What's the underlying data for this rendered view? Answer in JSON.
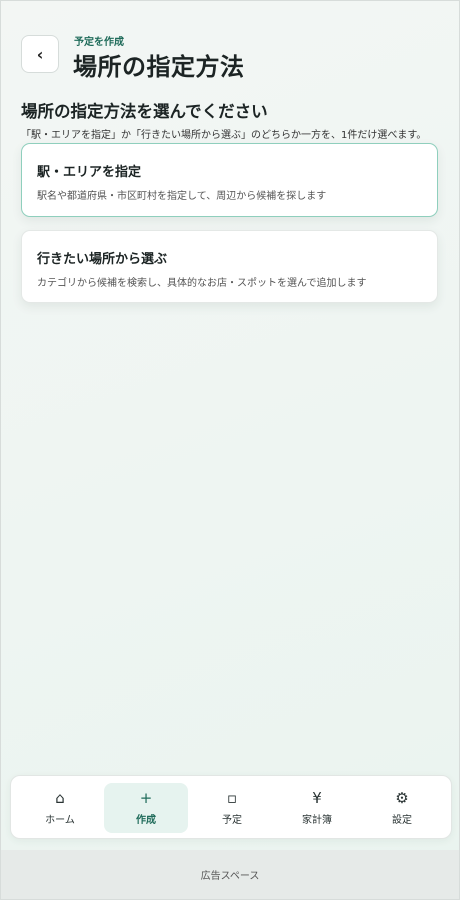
{
  "header": {
    "back_label": "‹",
    "eyebrow": "予定を作成",
    "title": "場所の指定方法"
  },
  "section": {
    "heading": "場所の指定方法を選んでください",
    "description": "「駅・エリアを指定」か「行きたい場所から選ぶ」のどちらか一方を、1件だけ選べます。"
  },
  "options": [
    {
      "title": "駅・エリアを指定",
      "description": "駅名や都道府県・市区町村を指定して、周辺から候補を探します",
      "selected": true
    },
    {
      "title": "行きたい場所から選ぶ",
      "description": "カテゴリから候補を検索し、具体的なお店・スポットを選んで追加します",
      "selected": false
    }
  ],
  "tabbar": {
    "items": [
      {
        "icon": "home-icon",
        "glyph": "⌂",
        "label": "ホーム"
      },
      {
        "icon": "plus-icon",
        "glyph": "+",
        "label": "作成",
        "active": true
      },
      {
        "icon": "calendar-icon",
        "glyph": "▫",
        "label": "予定"
      },
      {
        "icon": "yen-icon",
        "glyph": "¥",
        "label": "家計簿"
      },
      {
        "icon": "gear-icon",
        "glyph": "⚙",
        "label": "設定"
      }
    ]
  },
  "ad": {
    "label": "広告スペース"
  },
  "colors": {
    "accent": "#1f6b5a",
    "selected_border": "#8fcfbd",
    "active_tab_bg": "#e6f3ef"
  }
}
